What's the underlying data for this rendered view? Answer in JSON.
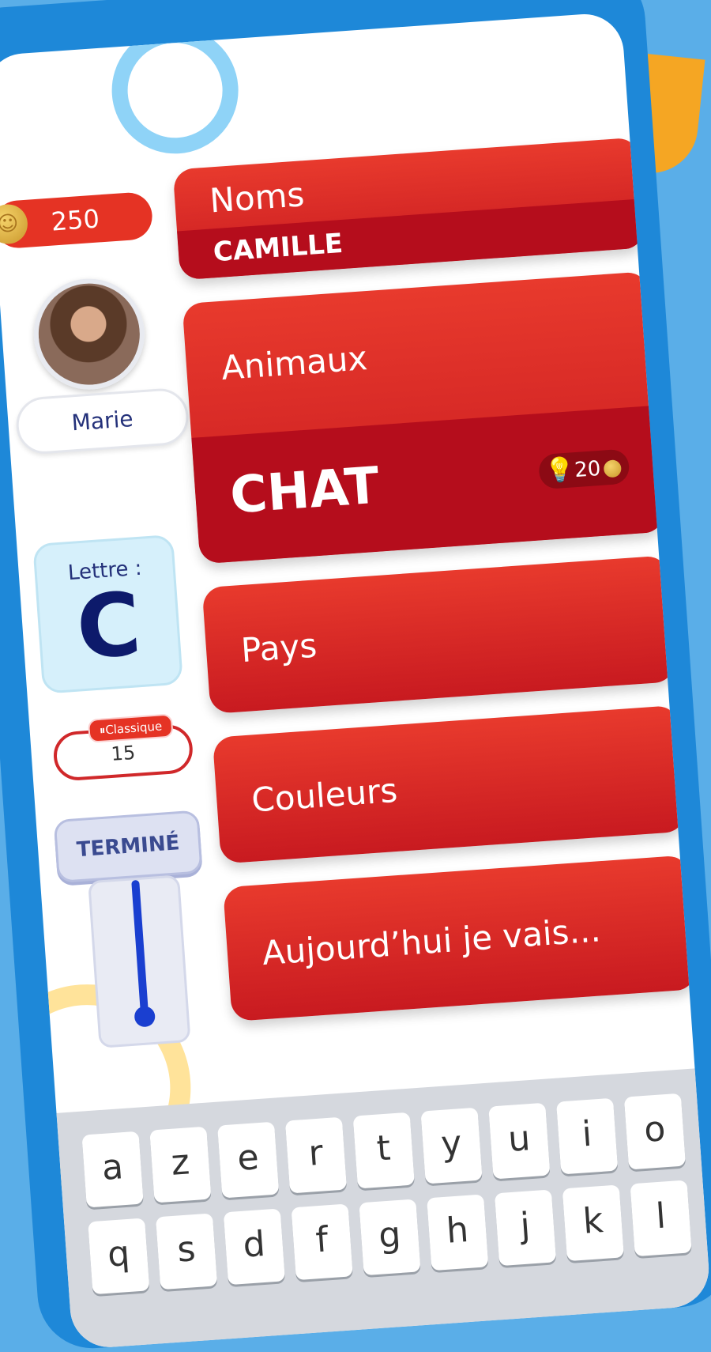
{
  "coins": {
    "value": "250",
    "icon": "coin-icon"
  },
  "player": {
    "name": "Marie"
  },
  "letter": {
    "label": "Lettre :",
    "value": "C"
  },
  "mode": {
    "badge": "Classique",
    "value": "15"
  },
  "done_button": {
    "label": "TERMINÉ"
  },
  "categories": [
    {
      "label": "Noms",
      "answer": "CAMILLE"
    },
    {
      "label": "Animaux",
      "answer": "CHAT",
      "hint_cost": "20"
    },
    {
      "label": "Pays"
    },
    {
      "label": "Couleurs"
    },
    {
      "label": "Aujourd’hui je vais..."
    }
  ],
  "keyboard": {
    "row1": [
      "a",
      "z",
      "e",
      "r",
      "t",
      "y",
      "u",
      "i",
      "o"
    ],
    "row2": [
      "q",
      "s",
      "d",
      "f",
      "g",
      "h",
      "j",
      "k",
      "l"
    ]
  },
  "colors": {
    "accent": "#e53324",
    "answer_band": "#b50d1c",
    "frame": "#1e88d8",
    "text_dark": "#24317a"
  }
}
